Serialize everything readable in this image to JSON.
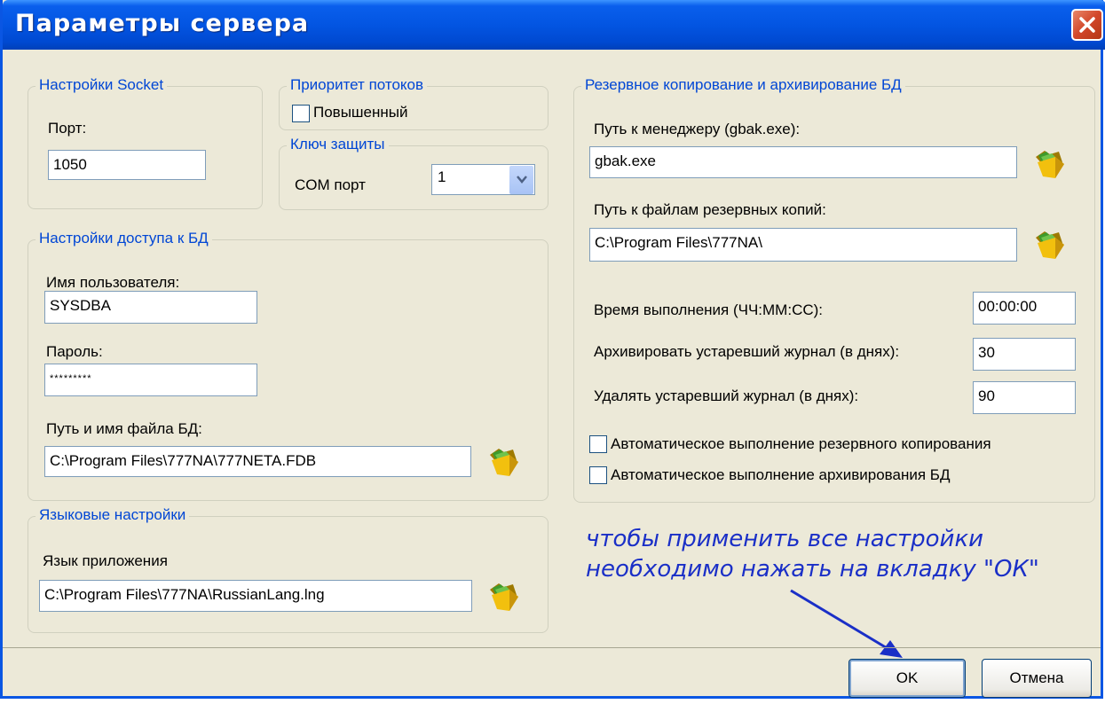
{
  "window": {
    "title": "Параметры сервера"
  },
  "socket": {
    "legend": "Настройки Socket",
    "port_label": "Порт:",
    "port_value": "1050"
  },
  "threads": {
    "legend": "Приоритет потоков",
    "elevated_label": "Повышенный",
    "elevated_checked": false
  },
  "key": {
    "legend": "Ключ защиты",
    "com_label": "COM порт",
    "com_value": "1"
  },
  "db_access": {
    "legend": "Настройки доступа к БД",
    "user_label": "Имя пользователя:",
    "user_value": "SYSDBA",
    "password_label": "Пароль:",
    "password_value": "*********",
    "path_label": "Путь и имя файла БД:",
    "path_value": "C:\\Program Files\\777NA\\777NETA.FDB"
  },
  "language": {
    "legend": "Языковые настройки",
    "app_lang_label": "Язык приложения",
    "app_lang_value": "C:\\Program Files\\777NA\\RussianLang.lng"
  },
  "backup": {
    "legend": "Резервное копирование и архивирование БД",
    "manager_label": "Путь к менеджеру (gbak.exe):",
    "manager_value": "gbak.exe",
    "files_label": "Путь к файлам резервных копий:",
    "files_value": "C:\\Program Files\\777NA\\",
    "time_label": "Время выполнения (ЧЧ:ММ:СС):",
    "time_value": "00:00:00",
    "archive_label": "Архивировать устаревший журнал (в днях):",
    "archive_value": "30",
    "delete_label": "Удалять устаревший журнал (в днях):",
    "delete_value": "90",
    "auto_backup_label": "Автоматическое выполнение резервного копирования",
    "auto_archive_label": "Автоматическое выполнение архивирования БД"
  },
  "annotation": {
    "line1": "чтобы применить все настройки",
    "line2": "необходимо нажать на вкладку \"ОК\""
  },
  "buttons": {
    "ok": "OK",
    "cancel": "Отмена"
  },
  "colors": {
    "title_bar": "#0355E2",
    "legend_text": "#0046D5",
    "annotation": "#1A2FC7",
    "arrow": "#1A2FC7"
  },
  "icons": {
    "folder_open": "folder-open-icon",
    "close": "close-icon"
  }
}
